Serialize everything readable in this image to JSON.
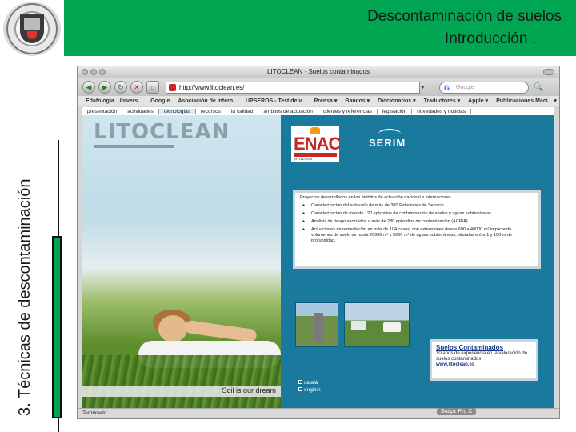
{
  "slide": {
    "title_line1": "Descontaminación de suelos",
    "title_line2": "Introducción  .",
    "side_label": "3.  Técnicas de descontaminación"
  },
  "browser": {
    "window_title": "LITOCLEAN - Suelos contaminados",
    "url": "http://www.litoclean.es/",
    "search_placeholder": "Google",
    "bookmarks": [
      "Edafología. Univers...",
      "Google",
      "Asociación de Intern...",
      "UPSEROS - Test de v...",
      "Prensa ▾",
      "Bancos ▾",
      "Diccionarios ▾",
      "Traductores ▾",
      "Apple ▾",
      "Publicaciones Maci... ▾"
    ],
    "status": "Terminado",
    "snapz_label": "Snapz Pro X"
  },
  "site": {
    "nav": [
      "presentación",
      "actividades",
      "tecnologías",
      "recursos",
      "la calidad",
      "ámbitos de actuación",
      "clientes y referencias",
      "legislación",
      "novedades y noticias"
    ],
    "logo": "LITOCLEAN",
    "slogan": "Soil is our dream",
    "enac_word": "ENAC",
    "enac_sub": "Nº 111/C435",
    "serim": "SERIM",
    "projects_header": "Proyectos desarrollados en los ámbitos de actuación nacional e internacional:",
    "projects": [
      "Caracterización del subsuelo de más de 380 Estaciones de Servicio.",
      "Caracterización de más de 120 episodios de contaminación de suelos y aguas subterráneas.",
      "Análisis de riesgo asociados a más de 280 episodios de contaminación (ACR/A).",
      "Actuaciones de remediación en más de 104 casos, con extensiones desde 600 a 40000 m² implicando volúmenes de suelo de hasta 25000 m³ y 5000 m³ de aguas subterráneas, situadas entre 1 y 180 m de profundidad."
    ],
    "promo_title": "Suelos Contaminados",
    "promo_text": "10 años de experiencia en la valoración de suelos contaminados",
    "promo_url": "www.litoclean.es",
    "languages": [
      "català",
      "english"
    ]
  }
}
